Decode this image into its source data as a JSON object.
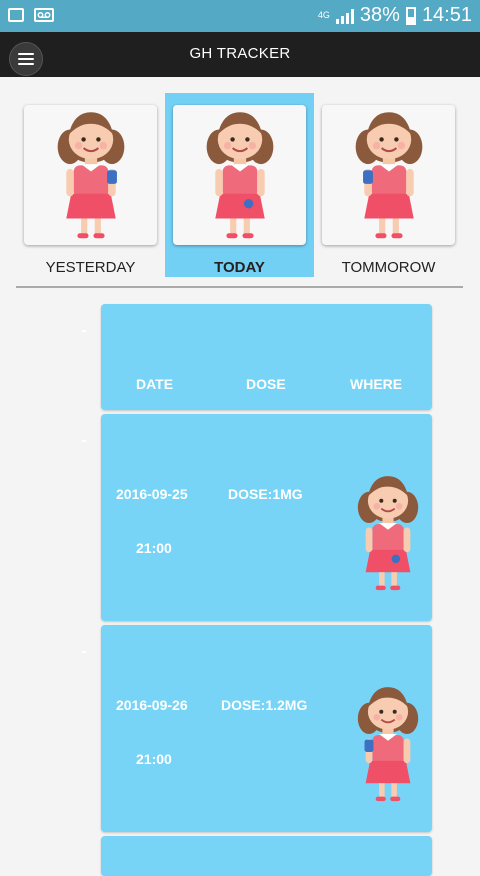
{
  "status_bar": {
    "network": "4G",
    "battery": "38%",
    "time": "14:51"
  },
  "app_bar": {
    "title": "GH TRACKER"
  },
  "days": [
    {
      "label": "YESTERDAY",
      "selected": false,
      "patch": "arm"
    },
    {
      "label": "TODAY",
      "selected": true,
      "patch": "belly"
    },
    {
      "label": "TOMMOROW",
      "selected": false,
      "patch": "arm"
    }
  ],
  "table": {
    "headers": {
      "date": "DATE",
      "dose": "DOSE",
      "where": "WHERE"
    },
    "rows": [
      {
        "date": "2016-09-25",
        "time": "21:00",
        "dose": "DOSE:1MG",
        "where_icon": "girl-belly-patch-icon"
      },
      {
        "date": "2016-09-26",
        "time": "21:00",
        "dose": "DOSE:1.2MG",
        "where_icon": "girl-arm-patch-icon"
      }
    ]
  },
  "colors": {
    "accent": "#78d4f7",
    "status_bar": "#54a9c4",
    "app_bar": "#1f1f1f"
  }
}
